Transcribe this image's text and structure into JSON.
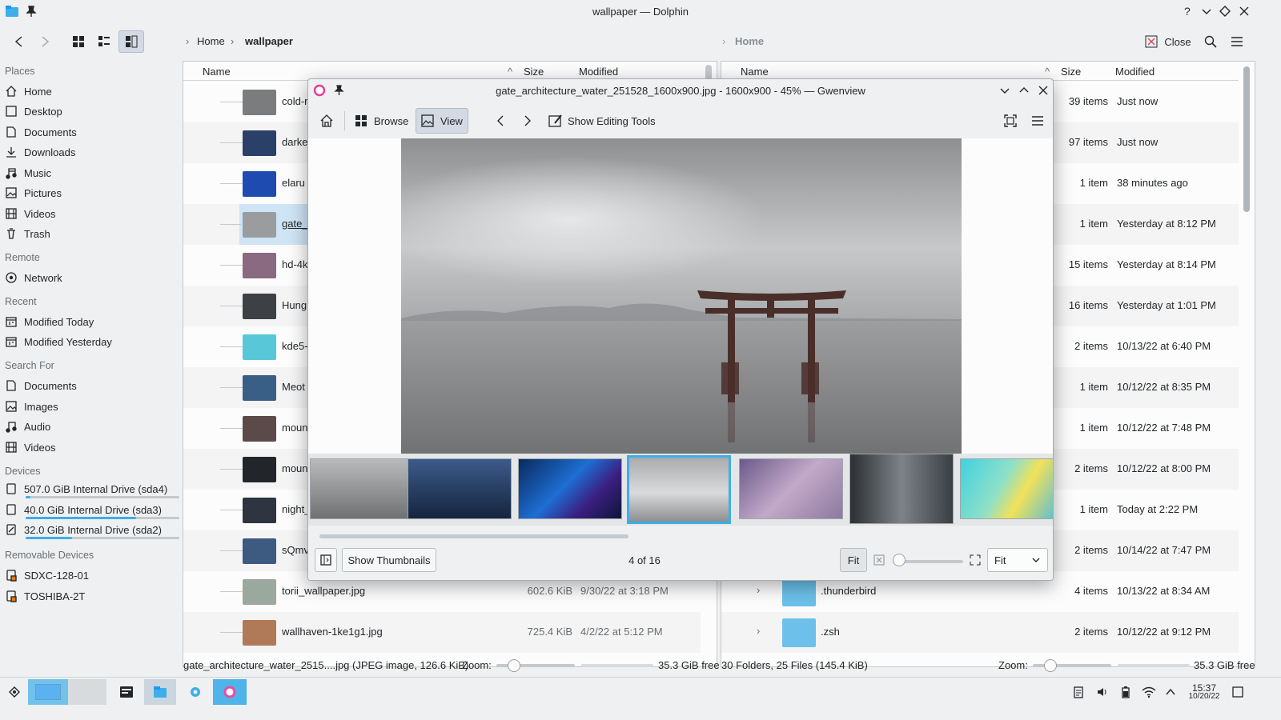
{
  "dolphin": {
    "title": "wallpaper — Dolphin",
    "breadcrumb_home": "Home",
    "breadcrumb_current": "wallpaper",
    "right_breadcrumb": "Home",
    "close_label": "Close",
    "columns": {
      "name": "Name",
      "size": "Size",
      "modified": "Modified"
    },
    "right_columns": {
      "name": "Name",
      "size": "Size",
      "modified": "Modified"
    }
  },
  "sidebar": {
    "places_header": "Places",
    "places": [
      "Home",
      "Desktop",
      "Documents",
      "Downloads",
      "Music",
      "Pictures",
      "Videos",
      "Trash"
    ],
    "remote_header": "Remote",
    "remote": [
      "Network"
    ],
    "recent_header": "Recent",
    "recent": [
      "Modified Today",
      "Modified Yesterday"
    ],
    "search_header": "Search For",
    "search": [
      "Documents",
      "Images",
      "Audio",
      "Videos"
    ],
    "devices_header": "Devices",
    "devices": [
      {
        "label": "507.0 GiB Internal Drive (sda4)",
        "used": 0.03
      },
      {
        "label": "40.0 GiB Internal Drive (sda3)",
        "used": 0.72
      },
      {
        "label": "32.0 GiB Internal Drive (sda2)",
        "used": 0.3
      }
    ],
    "removable_header": "Removable Devices",
    "removable": [
      "SDXC-128-01",
      "TOSHIBA-2T"
    ]
  },
  "left_files": [
    {
      "name": "cold-r",
      "size": "",
      "modified": ""
    },
    {
      "name": "darke",
      "size": "",
      "modified": ""
    },
    {
      "name": "elaru",
      "size": "",
      "modified": ""
    },
    {
      "name": "gate_",
      "size": "",
      "modified": ""
    },
    {
      "name": "hd-4k",
      "size": "",
      "modified": ""
    },
    {
      "name": "Hung",
      "size": "",
      "modified": ""
    },
    {
      "name": "kde5-",
      "size": "",
      "modified": ""
    },
    {
      "name": "Meot",
      "size": "",
      "modified": ""
    },
    {
      "name": "moun",
      "size": "",
      "modified": ""
    },
    {
      "name": "moun",
      "size": "",
      "modified": ""
    },
    {
      "name": "night_",
      "size": "",
      "modified": ""
    },
    {
      "name": "sQmv",
      "size": "",
      "modified": ""
    },
    {
      "name": "torii_wallpaper.jpg",
      "size": "602.6 KiB",
      "modified": "9/30/22 at 3:18 PM"
    },
    {
      "name": "wallhaven-1ke1g1.jpg",
      "size": "725.4 KiB",
      "modified": "4/2/22 at 5:12 PM"
    }
  ],
  "right_files": [
    {
      "name": "",
      "size": "39 items",
      "modified": "Just now"
    },
    {
      "name": "",
      "size": "97 items",
      "modified": "Just now"
    },
    {
      "name": "",
      "size": "1 item",
      "modified": "38 minutes ago"
    },
    {
      "name": "",
      "size": "1 item",
      "modified": "Yesterday at 8:12 PM"
    },
    {
      "name": "",
      "size": "15 items",
      "modified": "Yesterday at 8:14 PM"
    },
    {
      "name": "",
      "size": "16 items",
      "modified": "Yesterday at 1:01 PM"
    },
    {
      "name": "",
      "size": "2 items",
      "modified": "10/13/22 at 6:40 PM"
    },
    {
      "name": "",
      "size": "1 item",
      "modified": "10/12/22 at 8:35 PM"
    },
    {
      "name": "",
      "size": "1 item",
      "modified": "10/12/22 at 7:48 PM"
    },
    {
      "name": "",
      "size": "2 items",
      "modified": "10/12/22 at 8:00 PM"
    },
    {
      "name": "",
      "size": "1 item",
      "modified": "Today at 2:22 PM"
    },
    {
      "name": "",
      "size": "2 items",
      "modified": "10/14/22 at 7:47 PM"
    },
    {
      "name": ".thunderbird",
      "size": "4 items",
      "modified": "10/13/22 at 8:34 AM"
    },
    {
      "name": ".zsh",
      "size": "2 items",
      "modified": "10/12/22 at 9:12 PM"
    }
  ],
  "status": {
    "left_info": "gate_architecture_water_2515....jpg (JPEG image, 126.6 KiB)",
    "zoom_label": "Zoom:",
    "left_free": "35.3 GiB free",
    "right_info": "30 Folders, 25 Files (145.4 KiB)",
    "right_zoom_label": "Zoom:",
    "right_free": "35.3 GiB free"
  },
  "gwenview": {
    "title": "gate_architecture_water_251528_1600x900.jpg - 1600x900 - 45% — Gwenview",
    "browse_label": "Browse",
    "view_label": "View",
    "editing_label": "Show Editing Tools",
    "show_thumbnails": "Show Thumbnails",
    "counter": "4 of 16",
    "fit_button": "Fit",
    "fit_select": "Fit",
    "zoom_level": 0.0
  },
  "taskbar": {
    "time": "15:37",
    "date": "10/20/22"
  },
  "colors": {
    "accent": "#3daee9",
    "selection": "#cfe4f5",
    "folder": "#6cc0ea"
  }
}
